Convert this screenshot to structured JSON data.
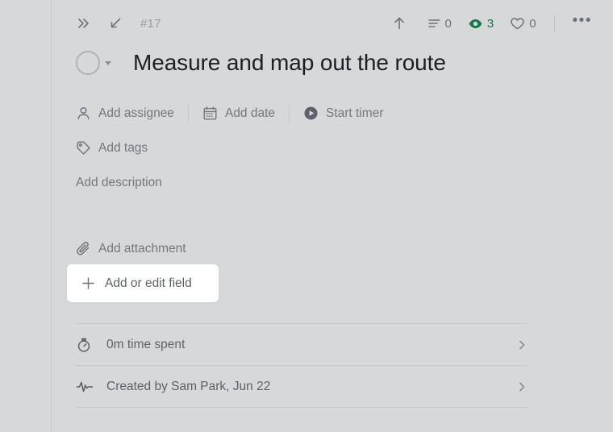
{
  "header": {
    "collapse_icon": "double-chevron-right-icon",
    "expand_icon": "diagonal-arrow-icon",
    "task_id": "#17",
    "share_icon": "up-arrow-icon",
    "stats": [
      {
        "icon": "subtask-list-icon",
        "name": "subtasks",
        "count": "0"
      },
      {
        "icon": "eye-icon",
        "name": "watchers",
        "count": "3",
        "color": "#19774a"
      },
      {
        "icon": "heart-icon",
        "name": "likes",
        "count": "0"
      }
    ],
    "more_label": "•••"
  },
  "title": {
    "status_icon": "status-circle-icon",
    "status_caret_icon": "caret-down-icon",
    "text": "Measure and map out the route"
  },
  "meta": {
    "row1": [
      {
        "icon": "person-icon",
        "label": "Add assignee"
      },
      {
        "icon": "calendar-icon",
        "label": "Add date"
      },
      {
        "icon": "play-circle-icon",
        "label": "Start timer"
      }
    ],
    "row2": [
      {
        "icon": "tag-icon",
        "label": "Add tags"
      }
    ],
    "description_placeholder": "Add description",
    "attachment": {
      "icon": "paperclip-icon",
      "label": "Add attachment"
    }
  },
  "field_card": {
    "icon": "plus-icon",
    "label": "Add or edit field"
  },
  "bottom_rows": [
    {
      "icon": "stopwatch-icon",
      "label": "0m time spent",
      "chevron": "chevron-right-icon"
    },
    {
      "icon": "activity-pulse-icon",
      "label": "Created by Sam Park, Jun 22",
      "chevron": "chevron-right-icon"
    }
  ],
  "colors": {
    "background": "#d7d8d9",
    "card": "#ffffff",
    "text_primary": "#1d1f26",
    "text_muted": "#74777e",
    "accent_green": "#19774a",
    "separator": "#c8c9cb"
  }
}
